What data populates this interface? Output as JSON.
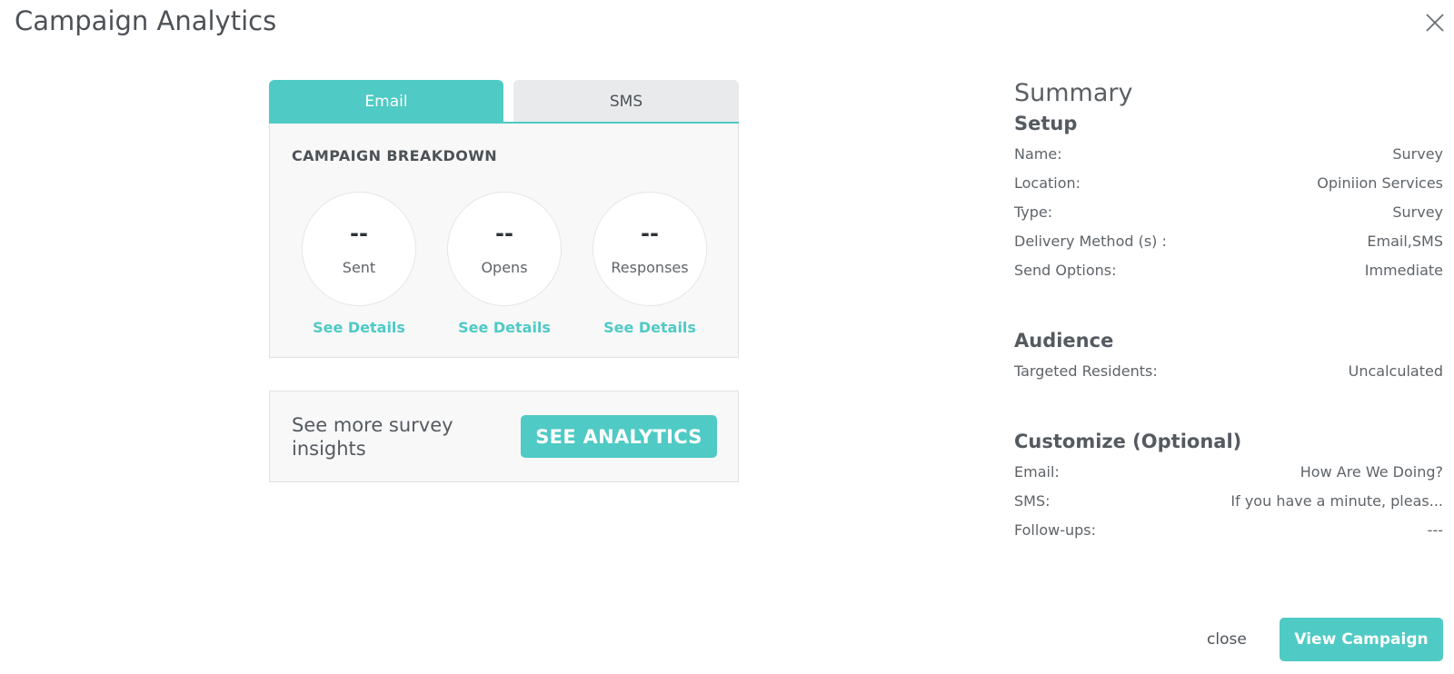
{
  "header": {
    "title": "Campaign Analytics",
    "close_icon": "close-icon"
  },
  "tabs": [
    {
      "label": "Email",
      "active": true
    },
    {
      "label": "SMS",
      "active": false
    }
  ],
  "breakdown": {
    "title": "CAMPAIGN BREAKDOWN",
    "metrics": [
      {
        "value": "--",
        "label": "Sent",
        "link": "See Details"
      },
      {
        "value": "--",
        "label": "Opens",
        "link": "See Details"
      },
      {
        "value": "--",
        "label": "Responses",
        "link": "See Details"
      }
    ]
  },
  "insights": {
    "text": "See more survey insights",
    "button_label": "SEE ANALYTICS"
  },
  "summary": {
    "heading": "Summary",
    "setup": {
      "heading": "Setup",
      "rows": [
        {
          "label": "Name:",
          "value": "Survey"
        },
        {
          "label": "Location:",
          "value": "Opiniion Services"
        },
        {
          "label": "Type:",
          "value": "Survey"
        },
        {
          "label": "Delivery Method (s) :",
          "value": "Email,SMS"
        },
        {
          "label": "Send Options:",
          "value": "Immediate"
        }
      ]
    },
    "audience": {
      "heading": "Audience",
      "rows": [
        {
          "label": "Targeted Residents:",
          "value": "Uncalculated"
        }
      ]
    },
    "customize": {
      "heading": "Customize (Optional)",
      "rows": [
        {
          "label": "Email:",
          "value": "How Are We Doing?"
        },
        {
          "label": "SMS:",
          "value": "If you have a minute, pleas..."
        },
        {
          "label": "Follow-ups:",
          "value": "---"
        }
      ]
    }
  },
  "footer": {
    "close_label": "close",
    "view_label": "View Campaign"
  },
  "colors": {
    "accent": "#4fcac5",
    "tab_inactive": "#e9eaec",
    "panel_bg": "#f8f8f8",
    "text": "#555a60"
  }
}
